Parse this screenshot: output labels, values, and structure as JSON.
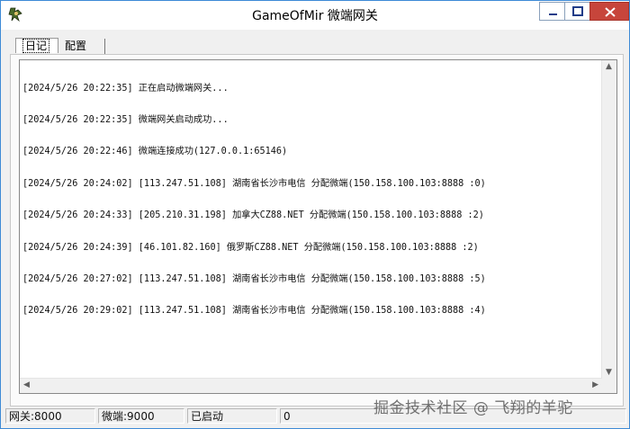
{
  "window": {
    "title": "GameOfMir 微端网关"
  },
  "tabs": [
    {
      "label": "日记",
      "active": true
    },
    {
      "label": "配置",
      "active": false
    }
  ],
  "log": {
    "lines": [
      "[2024/5/26 20:22:35] 正在启动微端网关...",
      "[2024/5/26 20:22:35] 微端网关启动成功...",
      "[2024/5/26 20:22:46] 微端连接成功(127.0.0.1:65146)",
      "[2024/5/26 20:24:02] [113.247.51.108] 湖南省长沙市电信 分配微端(150.158.100.103:8888 :0)",
      "[2024/5/26 20:24:33] [205.210.31.198] 加拿大CZ88.NET 分配微端(150.158.100.103:8888 :2)",
      "[2024/5/26 20:24:39] [46.101.82.160] 俄罗斯CZ88.NET 分配微端(150.158.100.103:8888 :2)",
      "[2024/5/26 20:27:02] [113.247.51.108] 湖南省长沙市电信 分配微端(150.158.100.103:8888 :5)",
      "[2024/5/26 20:29:02] [113.247.51.108] 湖南省长沙市电信 分配微端(150.158.100.103:8888 :4)"
    ]
  },
  "status": {
    "gateway": "网关:8000",
    "microend": "微端:9000",
    "state": "已启动",
    "count": "0"
  },
  "watermark": "掘金技术社区 @ 飞翔的羊驼",
  "colors": {
    "close_button": "#c7453b",
    "border": "#3d8ad6"
  },
  "icons": {
    "app": "app-icon",
    "minimize": "minimize-icon",
    "maximize": "maximize-icon",
    "close": "close-icon"
  }
}
